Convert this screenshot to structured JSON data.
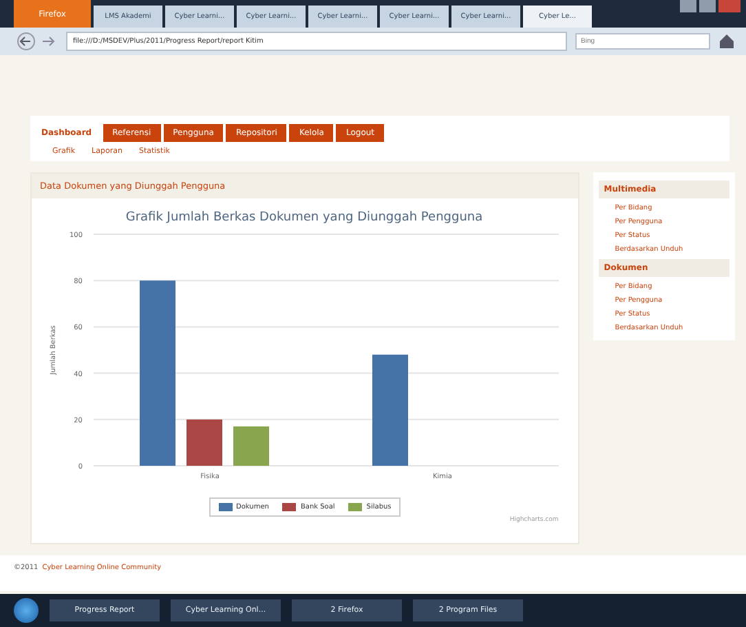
{
  "browser": {
    "menu_button": "Firefox",
    "tabs": [
      {
        "label": "LMS Akademi",
        "selected": false
      },
      {
        "label": "Cyber Learni...",
        "selected": false
      },
      {
        "label": "Cyber Learni...",
        "selected": false
      },
      {
        "label": "Cyber Learni...",
        "selected": false
      },
      {
        "label": "Cyber Learni...",
        "selected": false
      },
      {
        "label": "Cyber Learni...",
        "selected": false
      },
      {
        "label": "Cyber Le...",
        "selected": true
      }
    ],
    "url": "file:///D:/MSDEV/Plus/2011/Progress Report/report Kitim",
    "search": {
      "placeholder": "Bing"
    }
  },
  "nav": [
    {
      "label": "Dashboard",
      "selected": true
    },
    {
      "label": "Referensi",
      "selected": false
    },
    {
      "label": "Pengguna",
      "selected": false
    },
    {
      "label": "Repositori",
      "selected": false
    },
    {
      "label": "Kelola",
      "selected": false
    },
    {
      "label": "Logout",
      "selected": false
    }
  ],
  "subnav": [
    "Grafik",
    "Laporan",
    "Statistik"
  ],
  "panel": {
    "title": "Data Dokumen yang Diunggah Pengguna",
    "credit": "Highcharts.com",
    "chart_data": {
      "type": "bar",
      "title": "Grafik Jumlah Berkas Dokumen yang Diunggah Pengguna",
      "ylabel": "Jumlah Berkas",
      "categories": [
        "Fisika",
        "Kimia"
      ],
      "series": [
        {
          "name": "Dokumen",
          "color": "#4572a7",
          "values": [
            80,
            48
          ]
        },
        {
          "name": "Bank Soal",
          "color": "#aa4643",
          "values": [
            20,
            null
          ]
        },
        {
          "name": "Silabus",
          "color": "#89a54e",
          "values": [
            17,
            null
          ]
        }
      ],
      "grid": true,
      "legend": true,
      "ylim": [
        0,
        100
      ],
      "yticks": [
        0,
        20,
        40,
        60,
        80,
        100
      ]
    }
  },
  "sidebar": [
    {
      "title": "Multimedia",
      "items": [
        "Per Bidang",
        "Per Pengguna",
        "Per Status",
        "Berdasarkan Unduh"
      ]
    },
    {
      "title": "Dokumen",
      "items": [
        "Per Bidang",
        "Per Pengguna",
        "Per Status",
        "Berdasarkan Unduh"
      ]
    }
  ],
  "footer": {
    "prefix": "©2011",
    "link": "Cyber Learning Online Community"
  },
  "taskbar": [
    "Progress Report",
    "Cyber Learning Onl...",
    "2 Firefox",
    "2 Program Files"
  ]
}
